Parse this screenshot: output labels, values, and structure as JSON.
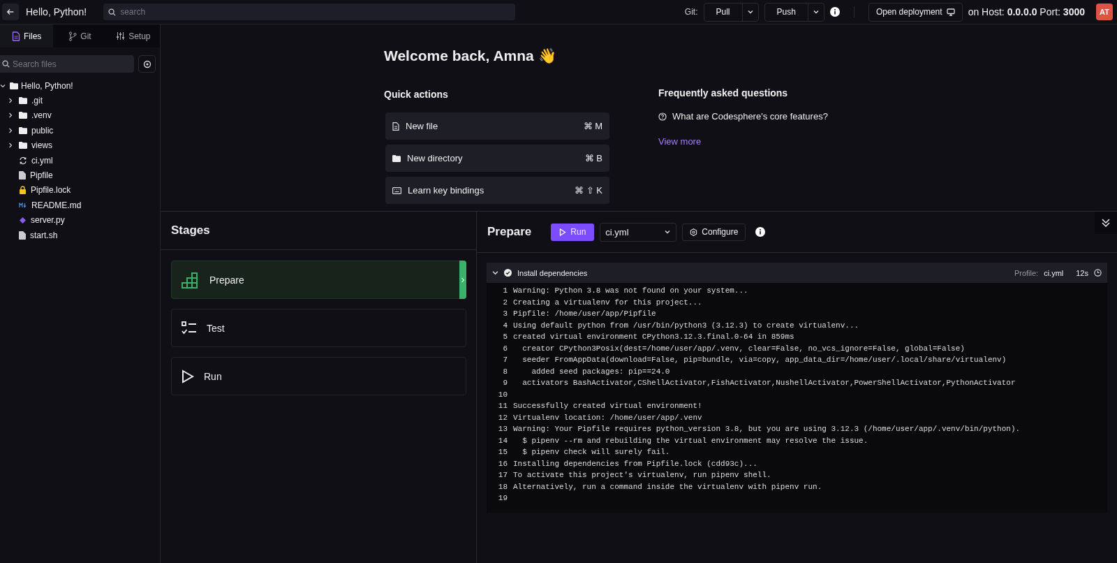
{
  "topbar": {
    "title": "Hello, Python!",
    "search": {
      "placeholder": "search"
    },
    "git_label": "Git:",
    "git_buttons": [
      "Pull",
      "Push"
    ],
    "deploy_button": "Open deployment",
    "host": "on Host: **0.0.0.0** Port: **3000**",
    "avatar": "AT"
  },
  "sidebar": {
    "tabs": [
      {
        "label": "Files",
        "kind": "files",
        "selected": true
      },
      {
        "label": "Git",
        "kind": "git",
        "selected": false
      },
      {
        "label": "Setup",
        "kind": "setup",
        "selected": false
      }
    ],
    "search": {
      "placeholder": "Search files"
    },
    "tree": [
      {
        "name": "Hello, Python!",
        "kind": "folder",
        "expanded": true,
        "children": [
          {
            "name": ".git",
            "kind": "folder",
            "expanded": false
          },
          {
            "name": ".venv",
            "kind": "folder",
            "expanded": false
          },
          {
            "name": "public",
            "kind": "folder",
            "expanded": false
          },
          {
            "name": "views",
            "kind": "folder",
            "expanded": false
          },
          {
            "name": "ci.yml",
            "kind": "ci"
          },
          {
            "name": "Pipfile",
            "kind": "file"
          },
          {
            "name": "Pipfile.lock",
            "kind": "lock"
          },
          {
            "name": "README.md",
            "kind": "markdown"
          },
          {
            "name": "server.py",
            "kind": "python"
          },
          {
            "name": "start.sh",
            "kind": "file"
          }
        ]
      }
    ]
  },
  "welcome": {
    "title": "Welcome back, Amna 👋",
    "quick_actions_title": "Quick actions",
    "quick_actions": [
      {
        "label": "New file",
        "kind": "file",
        "shortcut": "⌘ M"
      },
      {
        "label": "New directory",
        "kind": "folder",
        "shortcut": "⌘ B"
      },
      {
        "label": "Learn key bindings",
        "kind": "keyboard",
        "shortcut": "⌘ ⇧ K"
      }
    ],
    "faq_title": "Frequently asked questions",
    "faq": [
      "What are Codesphere's core features?"
    ],
    "view_more": "View more"
  },
  "stages": {
    "title": "Stages",
    "items": [
      {
        "label": "Prepare",
        "kind": "prepare",
        "selected": true
      },
      {
        "label": "Test",
        "kind": "test",
        "selected": false
      },
      {
        "label": "Run",
        "kind": "run",
        "selected": false
      }
    ]
  },
  "prepare": {
    "title": "Prepare",
    "run_button": "Run",
    "profile_select": "ci.yml",
    "configure_button": "Configure",
    "step": {
      "title": "Install dependencies",
      "expanded": true,
      "profile_label": "Profile:",
      "profile": "ci.yml",
      "duration": "12s"
    },
    "log": [
      {
        "n": "1",
        "text": "Warning: Python 3.8 was not found on your system..."
      },
      {
        "n": "2",
        "text": "Creating a virtualenv for this project..."
      },
      {
        "n": "3",
        "text": "Pipfile: /home/user/app/Pipfile"
      },
      {
        "n": "4",
        "text": "Using default python from /usr/bin/python3 (3.12.3) to create virtualenv..."
      },
      {
        "n": "5",
        "text": "created virtual environment CPython3.12.3.final.0-64 in 859ms"
      },
      {
        "n": "6",
        "text": "  creator CPython3Posix(dest=/home/user/app/.venv, clear=False, no_vcs_ignore=False, global=False)"
      },
      {
        "n": "7",
        "text": "  seeder FromAppData(download=False, pip=bundle, via=copy, app_data_dir=/home/user/.local/share/virtualenv)"
      },
      {
        "n": "8",
        "text": "    added seed packages: pip==24.0"
      },
      {
        "n": "9",
        "text": "  activators BashActivator,CShellActivator,FishActivator,NushellActivator,PowerShellActivator,PythonActivator"
      },
      {
        "n": "10"
      },
      {
        "n": "11",
        "text": "Successfully created virtual environment!"
      },
      {
        "n": "12",
        "text": "Virtualenv location: /home/user/app/.venv"
      },
      {
        "n": "13",
        "text": "Warning: Your Pipfile requires python_version 3.8, but you are using 3.12.3 (/home/user/app/.venv/bin/python)."
      },
      {
        "n": "14",
        "text": "  $ pipenv --rm and rebuilding the virtual environment may resolve the issue."
      },
      {
        "n": "15",
        "text": "  $ pipenv check will surely fail."
      },
      {
        "n": "16",
        "text": "Installing dependencies from Pipfile.lock (cdd93c)..."
      },
      {
        "n": "17",
        "text": "To activate this project's virtualenv, run pipenv shell."
      },
      {
        "n": "18",
        "text": "Alternatively, run a command inside the virtualenv with pipenv run."
      },
      {
        "n": "19"
      }
    ]
  }
}
